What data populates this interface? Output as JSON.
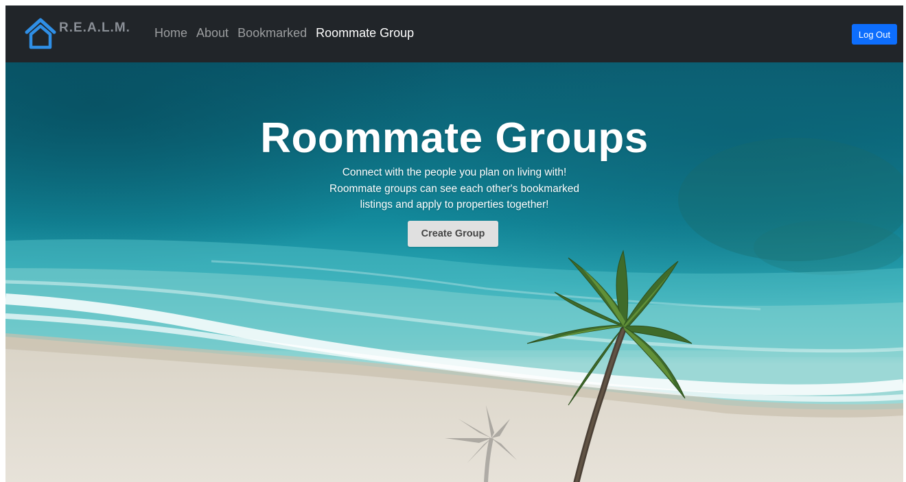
{
  "navbar": {
    "brand_text": "R.E.A.L.M.",
    "links": [
      {
        "label": "Home",
        "active": false
      },
      {
        "label": "About",
        "active": false
      },
      {
        "label": "Bookmarked",
        "active": false
      },
      {
        "label": "Roommate Group",
        "active": true
      }
    ],
    "logout_label": "Log Out"
  },
  "hero": {
    "title": "Roommate Groups",
    "description_lines": [
      "Connect with the people you plan on living with!",
      "Roommate groups can see each other's bookmarked",
      "listings and apply to properties together!"
    ],
    "create_button_label": "Create Group"
  },
  "icons": {
    "brand_logo": "house-icon",
    "background": "beach-aerial-palm-tree-image"
  },
  "colors": {
    "navbar_bg": "#212529",
    "brand_logo": "#2f8fe6",
    "active_link": "#ffffff",
    "inactive_link": "rgba(255,255,255,0.55)",
    "logout_button": "#0d6efd",
    "create_button": "#e0e0e0"
  }
}
